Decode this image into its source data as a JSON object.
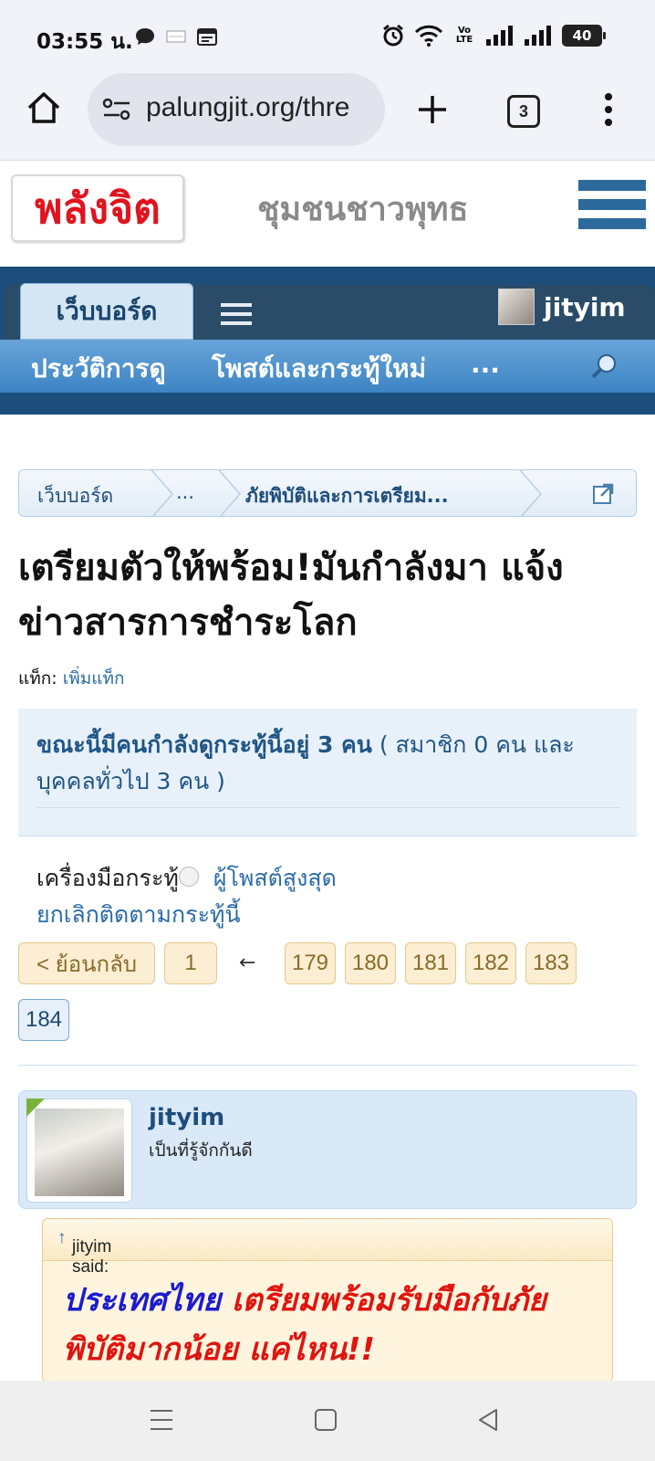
{
  "status_bar": {
    "time": "03:55 น.",
    "battery": "40",
    "network": "Vo LTE"
  },
  "browser": {
    "url": "palungjit.org/thre",
    "tab_count": "3"
  },
  "site": {
    "logo_text": "พลังจิต",
    "tagline": "ชุมชนชาวพุทธ"
  },
  "nav": {
    "active_tab": "เว็บบอร์ด",
    "username": "jityim",
    "sub_items": [
      "ประวัติการดู",
      "โพสต์และกระทู้ใหม่",
      "..."
    ]
  },
  "breadcrumb": [
    "เว็บบอร์ด",
    "...",
    "ภัยพิบัติและการเตรียม..."
  ],
  "thread": {
    "title": "เตรียมตัวให้พร้อม!มันกำลังมา แจ้งข่าวสารการชำระโลก",
    "tags_label": "แท็ก:",
    "tags_link": "เพิ่มแท็ก",
    "viewers_bold": "ขณะนี้มีคนกำลังดูกระทู้นี้อยู่ 3 คน",
    "viewers_rest": " ( สมาชิก 0 คน และ บุคคลทั่วไป 3 คน )",
    "tools_label": "เครื่องมือกระทู้",
    "top_posters": "ผู้โพสต์สูงสุด",
    "unfollow": "ยกเลิกติดตามกระทู้นี้"
  },
  "pagination": {
    "prev": "< ย้อนกลับ",
    "first": "1",
    "ellipsis_arrow": "←",
    "pages": [
      "179",
      "180",
      "181",
      "182",
      "183"
    ],
    "current": "184"
  },
  "post": {
    "author": "jityim",
    "rank": "เป็นที่รู้จักกันดี",
    "quote_header": "jityim said:",
    "quote_arrow": "↑",
    "quote_blue": "ประเทศไทย",
    "quote_red_1": " เตรียมพร้อมรับมือกับภัย",
    "quote_red_2": "พิบัติมากน้อย แค่ไหน!!"
  },
  "colors": {
    "nav_dark": "#1d4d7a",
    "link_blue": "#2a6ca8",
    "logo_red": "#e0141e"
  }
}
